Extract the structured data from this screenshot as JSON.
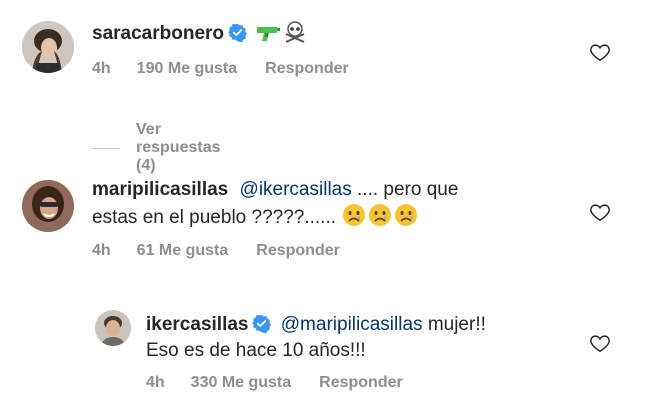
{
  "comments": [
    {
      "username": "saracarbonero",
      "text": "",
      "emojis": [
        "water-pistol-emoji",
        "skull-crossbones-emoji"
      ],
      "time": "4h",
      "likes": "190 Me gusta",
      "reply": "Responder",
      "view_replies": "Ver respuestas (4)"
    },
    {
      "username": "maripilicasillas",
      "mention": "@ikercasillas",
      "text_line1": ".... pero que",
      "text_line2": "estas en el pueblo ?????......",
      "emojis": [
        "sad-face-emoji",
        "sad-face-emoji",
        "sad-face-emoji"
      ],
      "time": "4h",
      "likes": "61 Me gusta",
      "reply": "Responder"
    },
    {
      "username": "ikercasillas",
      "mention": "@maripilicasillas",
      "text_line1": "mujer!!",
      "text_line2": "Eso es de hace 10 años!!!",
      "time": "4h",
      "likes": "330 Me gusta",
      "reply": "Responder"
    }
  ],
  "colors": {
    "text": "#262626",
    "meta": "#8e8e8e",
    "mention": "#00376b",
    "verified": "#3897f0"
  }
}
